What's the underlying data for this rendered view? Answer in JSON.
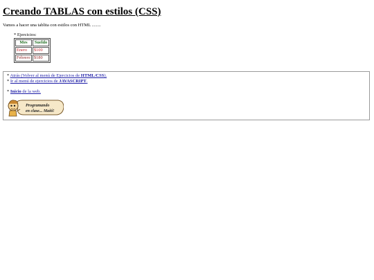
{
  "page": {
    "title": "Creando TABLAS con estilos (CSS)",
    "intro": "Vamos a hacer una tablita con estilos con HTML ........"
  },
  "exercises": {
    "label": "* Ejercicios:",
    "table": {
      "headers": [
        "Mes",
        "Sueldo"
      ],
      "rows": [
        [
          "Enero",
          "$100"
        ],
        [
          "Febrero",
          "$180"
        ]
      ]
    }
  },
  "nav": {
    "back": {
      "prefix": "* ",
      "link_text": "Atrás (Volver al menú de Ejercicios de ",
      "link_bold": "HTML/CSS",
      "link_suffix": ")."
    },
    "js": {
      "prefix": "* ",
      "link_text": "Ir al menú de ejercicios de ",
      "link_bold": "JAVASCRIPT",
      "link_suffix": "."
    },
    "home": {
      "prefix": "* ",
      "link_bold": "Inicio",
      "link_text": " de la web."
    },
    "logo": {
      "line1": "Programando",
      "line2": "en clase... Maiti!"
    }
  },
  "colors": {
    "header_text": "#1f6d1f",
    "cell_text": "#c1272d",
    "link": "#1a1aa6"
  }
}
